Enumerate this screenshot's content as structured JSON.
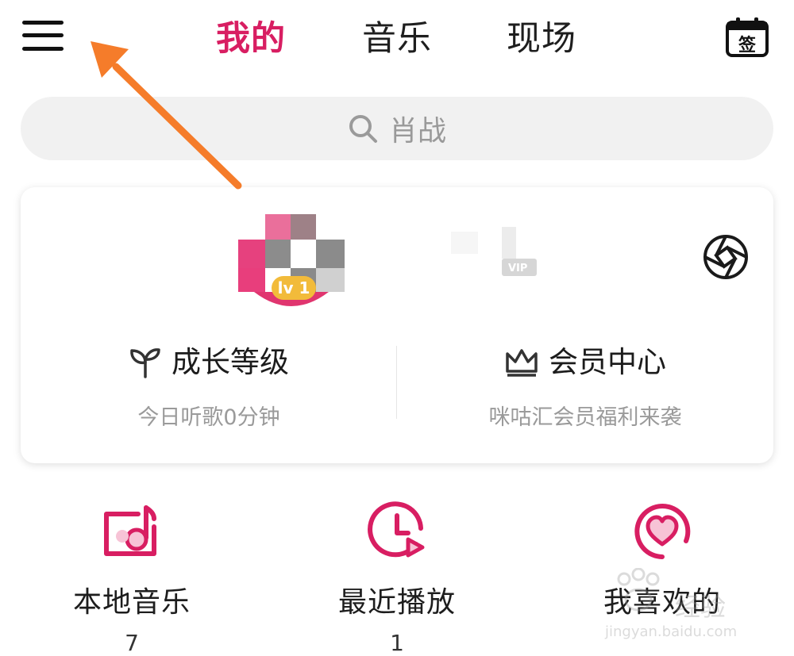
{
  "header": {
    "tabs": [
      {
        "label": "我的",
        "active": true
      },
      {
        "label": "音乐",
        "active": false
      },
      {
        "label": "现场",
        "active": false
      }
    ],
    "checkin_label": "签"
  },
  "search": {
    "placeholder": "肖战"
  },
  "profile": {
    "level_badge": "lv 1",
    "vip_label": "VIP",
    "growth": {
      "title": "成长等级",
      "subtitle": "今日听歌0分钟"
    },
    "member": {
      "title": "会员中心",
      "subtitle": "咪咕汇会员福利来袭"
    }
  },
  "quick_actions": [
    {
      "label": "本地音乐",
      "count": "7"
    },
    {
      "label": "最近播放",
      "count": "1"
    },
    {
      "label": "我喜欢的",
      "count": ""
    }
  ],
  "watermark": {
    "title": "经验",
    "url": "jingyan.baidu.com"
  },
  "colors": {
    "accent": "#d81e62",
    "annotation_arrow": "#f57c2a",
    "level_badge": "#f2bb3a"
  }
}
